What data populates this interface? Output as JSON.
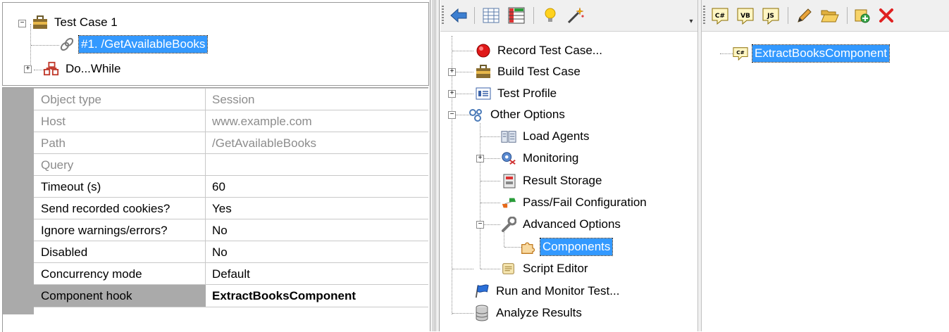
{
  "case_tree": {
    "root": "Test Case 1",
    "session": "#1. /GetAvailableBooks",
    "loop": "Do...While"
  },
  "properties": {
    "rows": [
      {
        "name": "Object type",
        "value": "Session"
      },
      {
        "name": "Host",
        "value": "www.example.com"
      },
      {
        "name": "Path",
        "value": "/GetAvailableBooks"
      },
      {
        "name": "Query",
        "value": ""
      },
      {
        "name": "Timeout (s)",
        "value": "60"
      },
      {
        "name": "Send recorded cookies?",
        "value": "Yes"
      },
      {
        "name": "Ignore warnings/errors?",
        "value": "No"
      },
      {
        "name": "Disabled",
        "value": "No"
      },
      {
        "name": "Concurrency mode",
        "value": "Default"
      },
      {
        "name": "Component hook",
        "value": "ExtractBooksComponent"
      }
    ]
  },
  "nav_tree": {
    "items": [
      {
        "label": "Record Test Case..."
      },
      {
        "label": "Build Test Case"
      },
      {
        "label": "Test Profile"
      },
      {
        "label": "Other Options"
      },
      {
        "label": "Load Agents"
      },
      {
        "label": "Monitoring"
      },
      {
        "label": "Result Storage"
      },
      {
        "label": "Pass/Fail Configuration"
      },
      {
        "label": "Advanced Options"
      },
      {
        "label": "Components"
      },
      {
        "label": "Script Editor"
      },
      {
        "label": "Run and Monitor Test..."
      },
      {
        "label": "Analyze Results"
      }
    ]
  },
  "components": {
    "items": [
      {
        "label": "ExtractBooksComponent"
      }
    ]
  },
  "icons": {
    "toolbar_mid": [
      "back-arrow-icon",
      "grid-icon",
      "table-grid-icon",
      "lightbulb-icon",
      "magic-wand-icon"
    ],
    "toolbar_right": [
      "csharp-component-icon",
      "vb-component-icon",
      "js-component-icon",
      "pencil-icon",
      "open-folder-icon",
      "new-item-icon",
      "delete-icon"
    ]
  },
  "colors": {
    "selection": "#3399ff",
    "gutter": "#aaaaaa",
    "toolbar": "#f0f0f0"
  }
}
